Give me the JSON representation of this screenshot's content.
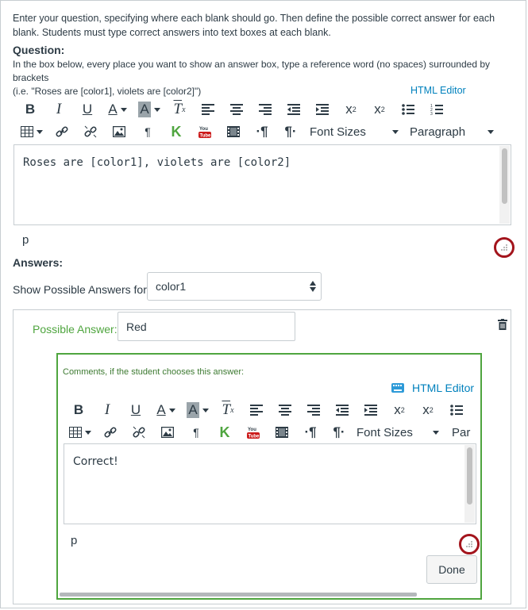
{
  "instructions": "Enter your question, specifying where each blank should go. Then define the possible correct answer for each blank. Students must type correct answers into text boxes at each blank.",
  "question": {
    "label": "Question:",
    "help_line1": "In the box below, every place you want to show an answer box, type a reference word (no spaces) surrounded by brackets",
    "help_line2": "(i.e. \"Roses are [color1], violets are [color2]\")",
    "html_editor_label": "HTML Editor",
    "content": "Roses are [color1], violets are [color2]",
    "path": "p",
    "font_sizes_label": "Font Sizes",
    "paragraph_label": "Paragraph"
  },
  "answers": {
    "label": "Answers:",
    "show_label": "Show Possible Answers for",
    "selected_blank": "color1",
    "possible_answer_label": "Possible Answer:",
    "possible_answer_value": "Red",
    "comments_label": "Comments, if the student chooses this answer:",
    "html_editor_label": "HTML Editor",
    "comment_content": "Correct!",
    "path": "p",
    "font_sizes_label": "Font Sizes",
    "paragraph_label_truncated": "Par",
    "done_label": "Done"
  },
  "colors": {
    "accent_green": "#4fa53f",
    "link_blue": "#0081bd",
    "highlight_red": "#a3141c"
  }
}
